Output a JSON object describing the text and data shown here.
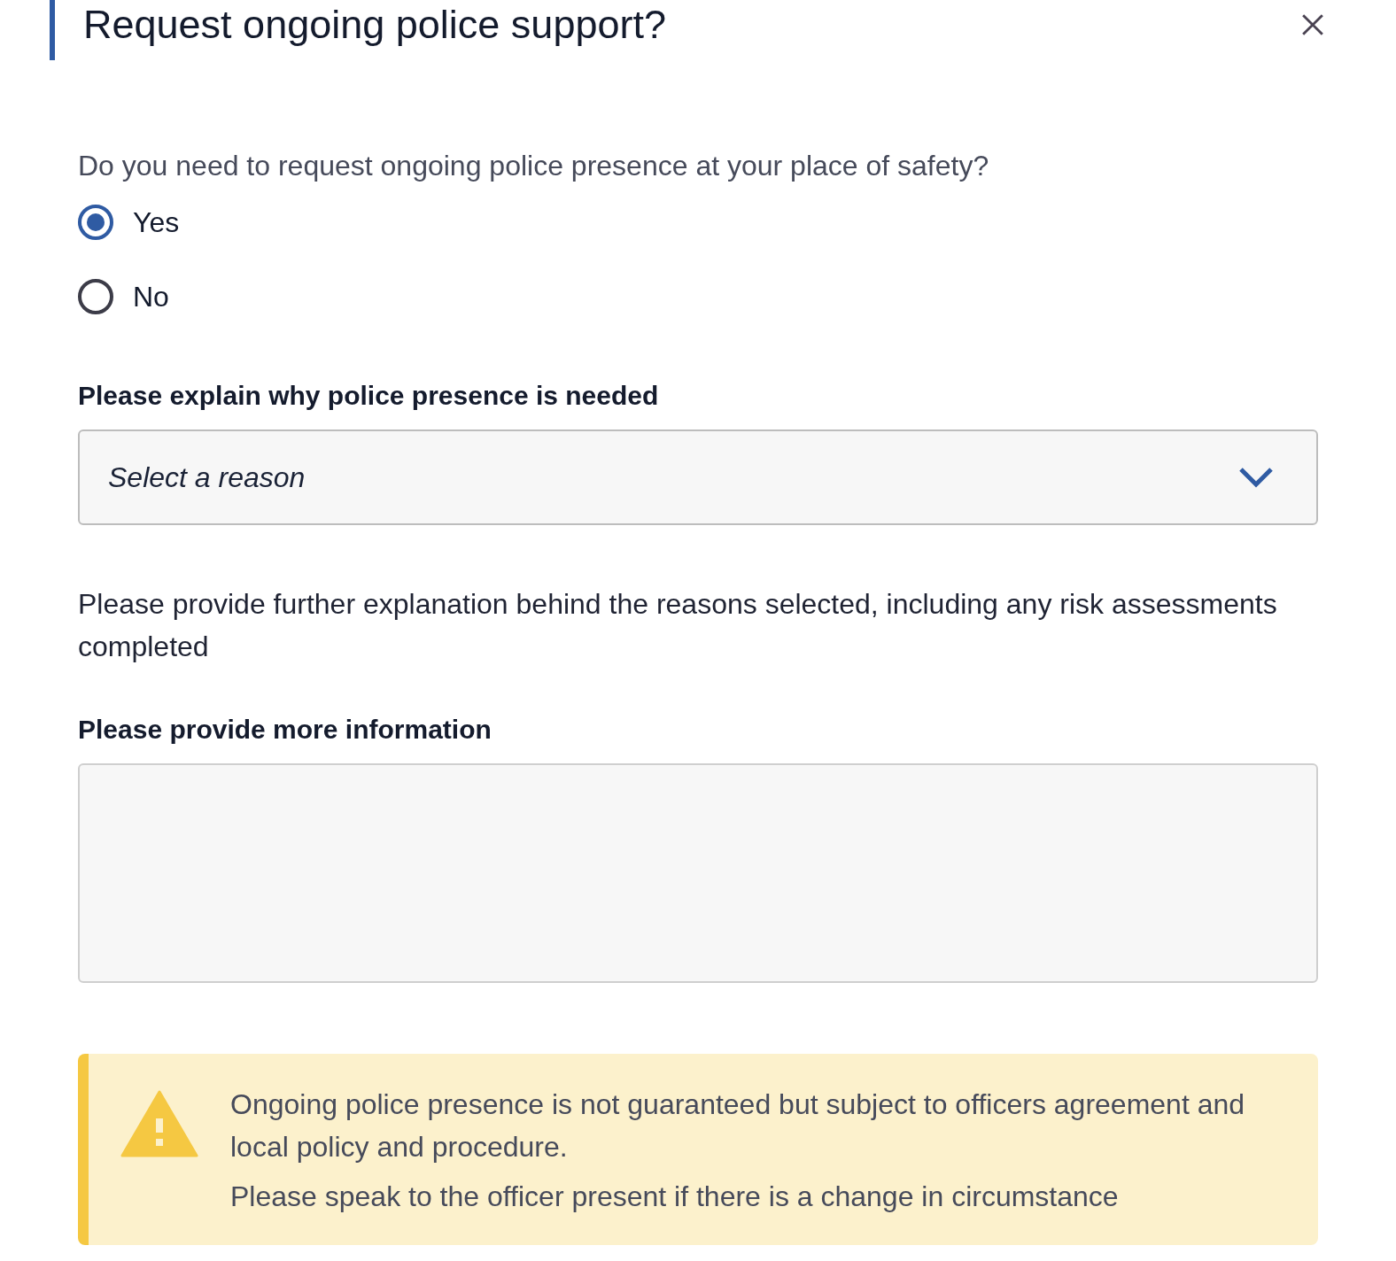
{
  "dialog": {
    "title": "Request ongoing police support?"
  },
  "question": {
    "text": "Do you need to request ongoing police presence at your place of safety?",
    "options": [
      {
        "label": "Yes",
        "selected": true
      },
      {
        "label": "No",
        "selected": false
      }
    ]
  },
  "reason_select": {
    "label": "Please explain why police presence is needed",
    "placeholder": "Select a reason"
  },
  "explanation": "Please provide further explanation behind the reasons selected, including any risk assessments completed",
  "more_info": {
    "label": "Please provide more information"
  },
  "warning": {
    "paragraphs": [
      "Ongoing police presence is not guaranteed but subject to officers agreement and local policy and procedure.",
      "Please speak to the officer present if there is a change in circumstance"
    ]
  }
}
